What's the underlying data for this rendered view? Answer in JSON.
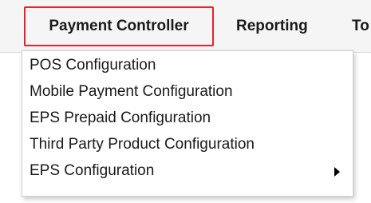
{
  "menubar": {
    "items": [
      {
        "label": "Payment Controller",
        "active": true
      },
      {
        "label": "Reporting"
      },
      {
        "label": "To"
      }
    ],
    "active_outline_color": "#e3242b"
  },
  "dropdown": {
    "items": [
      {
        "label": "POS Configuration"
      },
      {
        "label": "Mobile Payment Configuration"
      },
      {
        "label": "EPS Prepaid Configuration"
      },
      {
        "label": "Third Party Product Configuration"
      },
      {
        "label": "EPS Configuration",
        "has_submenu": true,
        "submenu_icon": "caret-right-icon"
      }
    ]
  }
}
